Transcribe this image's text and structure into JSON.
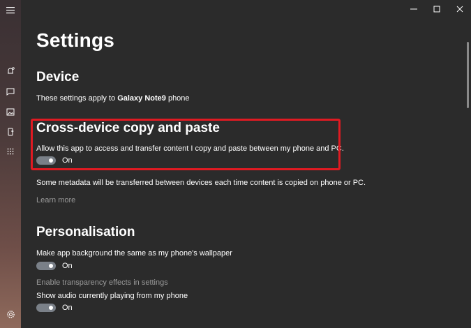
{
  "window": {
    "controls": [
      "minimize-icon",
      "maximize-icon",
      "close-icon"
    ]
  },
  "rail": {
    "items": [
      "menu-icon",
      "notifications-icon",
      "messages-icon",
      "photos-icon",
      "phone-screen-icon",
      "apps-icon",
      "settings-icon"
    ]
  },
  "page": {
    "title": "Settings"
  },
  "device": {
    "heading": "Device",
    "text_prefix": "These settings apply to ",
    "device_name": "Galaxy Note9",
    "text_suffix": " phone"
  },
  "cross_device": {
    "heading": "Cross-device copy and paste",
    "description": "Allow this app to access and transfer content I copy and paste between my phone and PC.",
    "toggle_label": "On",
    "toggle_on": true,
    "metadata_note": "Some metadata will be transferred between devices each time content is copied on phone or PC.",
    "learn_more": "Learn more",
    "highlight_color": "#e01a22"
  },
  "personalisation": {
    "heading": "Personalisation",
    "wallpaper_label": "Make app background the same as my phone's wallpaper",
    "wallpaper_toggle": "On",
    "transparency_link": "Enable transparency effects in settings",
    "audio_label": "Show audio currently playing from my phone",
    "audio_toggle": "On"
  },
  "colors": {
    "background": "#2b2b2b",
    "accent_highlight": "#e01a22",
    "muted_text": "#9a9a9a"
  }
}
